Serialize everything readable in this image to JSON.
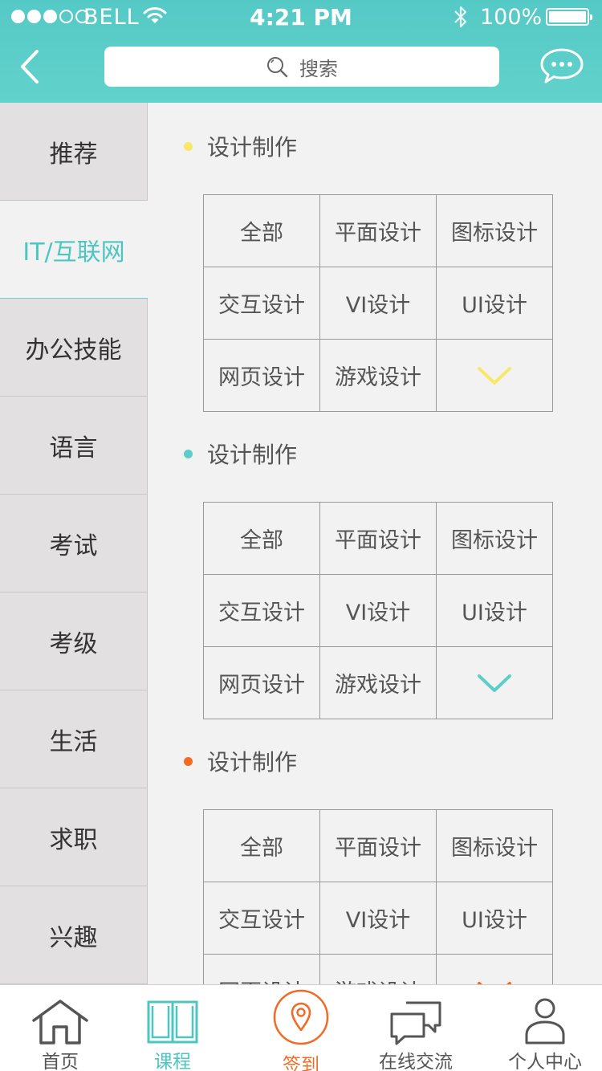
{
  "status_bar": {
    "carrier": "BELL",
    "time": "4:21 PM",
    "battery": "100%"
  },
  "header": {
    "search_placeholder": "搜索",
    "back_icon": "chevron-left-icon",
    "chat_icon": "chat-bubble-icon",
    "color": "#5ccdc8"
  },
  "sidebar": {
    "items": [
      {
        "label": "推荐",
        "active": false
      },
      {
        "label": "IT/互联网",
        "active": true
      },
      {
        "label": "办公技能",
        "active": false
      },
      {
        "label": "语言",
        "active": false
      },
      {
        "label": "考试",
        "active": false
      },
      {
        "label": "考级",
        "active": false
      },
      {
        "label": "生活",
        "active": false
      },
      {
        "label": "求职",
        "active": false
      },
      {
        "label": "兴趣",
        "active": false
      }
    ]
  },
  "sections": [
    {
      "title": "设计制作",
      "accent": "#f7e86a",
      "cells": [
        "全部",
        "平面设计",
        "图标设计",
        "交互设计",
        "VI设计",
        "UI设计",
        "网页设计",
        "游戏设计"
      ],
      "expand_icon": "chevron-down-icon"
    },
    {
      "title": "设计制作",
      "accent": "#5ccdc8",
      "cells": [
        "全部",
        "平面设计",
        "图标设计",
        "交互设计",
        "VI设计",
        "UI设计",
        "网页设计",
        "游戏设计"
      ],
      "expand_icon": "chevron-down-icon"
    },
    {
      "title": "设计制作",
      "accent": "#f26a23",
      "cells": [
        "全部",
        "平面设计",
        "图标设计",
        "交互设计",
        "VI设计",
        "UI设计",
        "网页设计",
        "游戏设计"
      ],
      "expand_icon": "chevron-down-icon"
    }
  ],
  "tabbar": {
    "items": [
      {
        "label": "首页",
        "icon": "home-icon",
        "active": false
      },
      {
        "label": "课程",
        "icon": "book-icon",
        "active": true
      },
      {
        "label": "签到",
        "icon": "location-pin-icon",
        "active": false,
        "highlight": true
      },
      {
        "label": "在线交流",
        "icon": "chat-icon",
        "active": false
      },
      {
        "label": "个人中心",
        "icon": "person-icon",
        "active": false
      }
    ],
    "active_color": "#4cc6c1",
    "checkin_color": "#f26a23"
  }
}
